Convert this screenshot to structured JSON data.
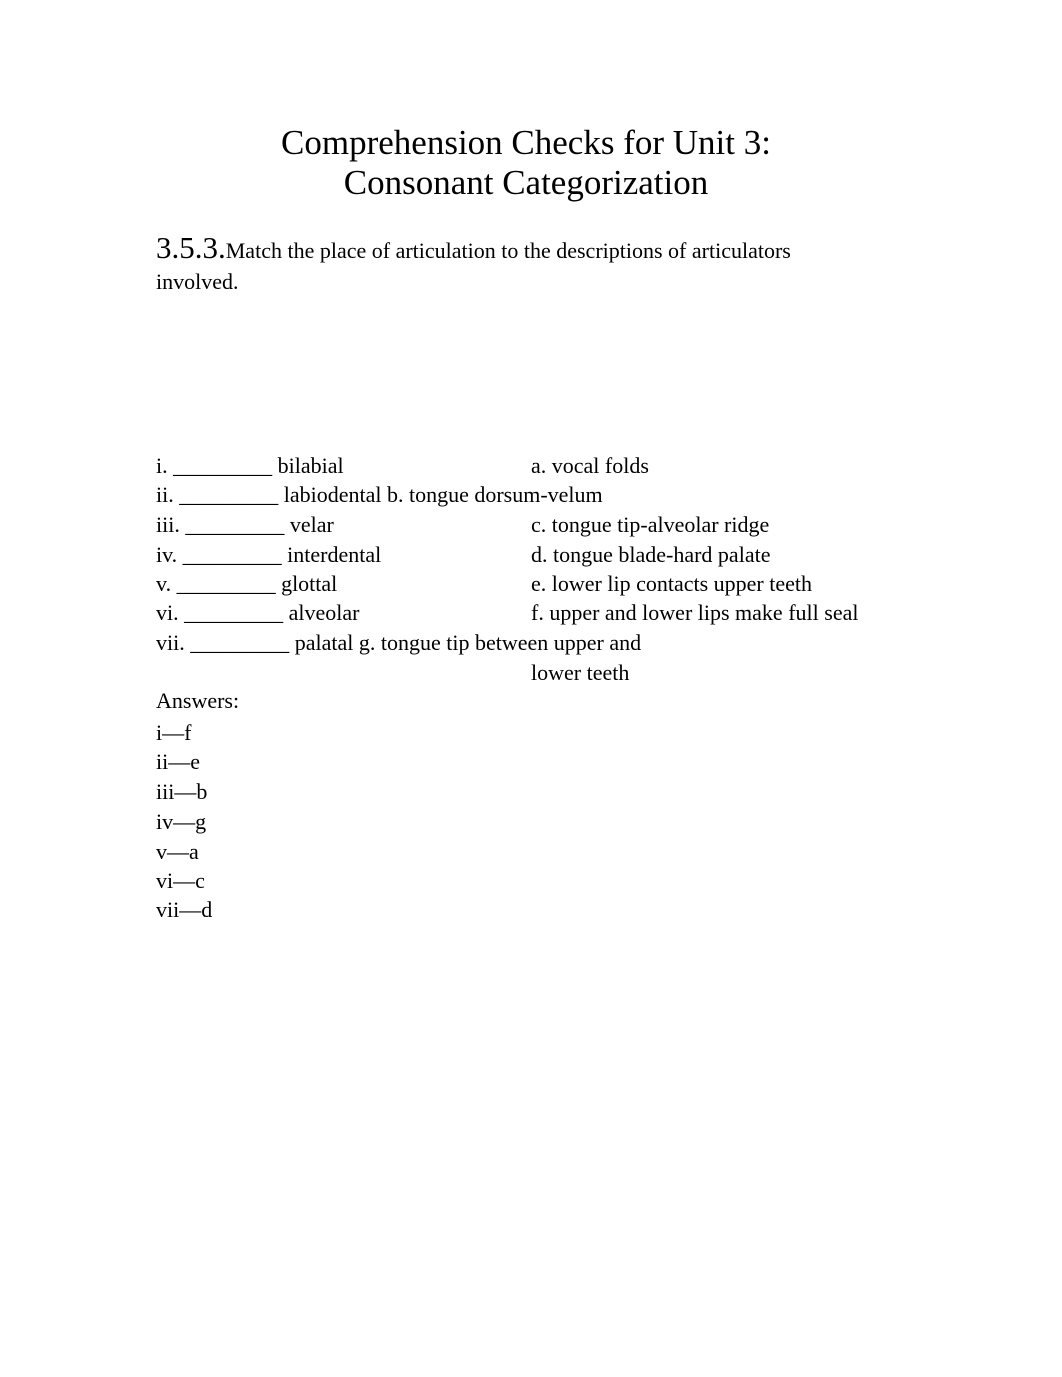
{
  "title": {
    "line1": "Comprehension Checks for Unit 3:",
    "line2": "Consonant Categorization"
  },
  "question": {
    "number": "3.5.3.",
    "text": "Match the place of articulation to the descriptions of articulators involved."
  },
  "matching": {
    "rows": [
      {
        "left": "i. _________ bilabial",
        "right": "a. vocal folds"
      },
      {
        "left": "ii. _________ labiodental b. tongue dorsum-velum",
        "right": ""
      },
      {
        "left": "iii. _________ velar",
        "right": "c. tongue tip-alveolar ridge"
      },
      {
        "left": "iv. _________ interdental",
        "right": "d. tongue blade-hard palate"
      },
      {
        "left": "v. _________ glottal",
        "right": "e. lower lip contacts upper teeth"
      },
      {
        "left": "vi. _________ alveolar",
        "right": "f. upper and lower lips make full seal"
      },
      {
        "left": "vii. _________ palatal g. tongue tip between upper and",
        "right": ""
      },
      {
        "left": "",
        "right": "lower teeth"
      }
    ]
  },
  "answers": {
    "heading": "Answers:",
    "items": [
      "i—f",
      "ii—e",
      "iii—b",
      "iv—g",
      "v—a",
      "vi—c",
      "vii—d"
    ]
  }
}
